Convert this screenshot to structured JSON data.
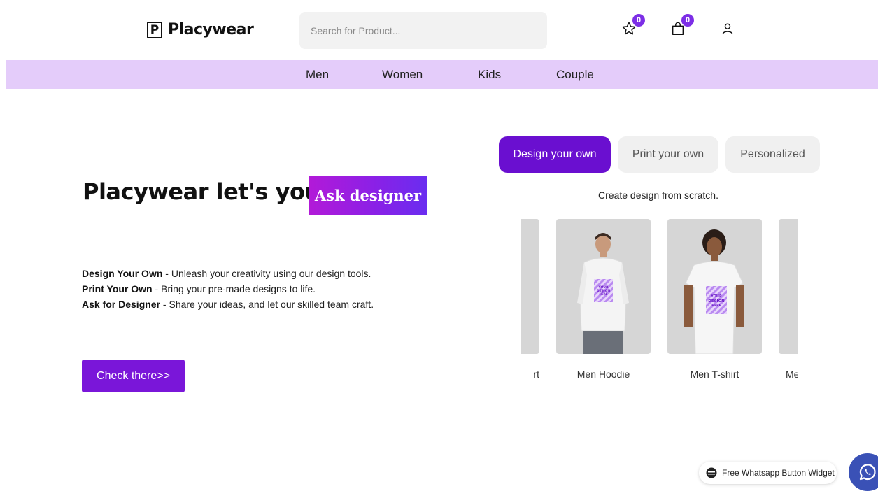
{
  "header": {
    "logo_mark": "P",
    "logo_text": "Placywear",
    "search_placeholder": "Search for Product...",
    "wishlist_count": "0",
    "cart_count": "0"
  },
  "nav": {
    "items": [
      "Men",
      "Women",
      "Kids",
      "Couple"
    ]
  },
  "hero": {
    "title": "Placywear let's you",
    "badge": "Ask designer",
    "lines": [
      {
        "bold": "Design Your Own",
        "text": " - Unleash your creativity using our design tools."
      },
      {
        "bold": "Print Your Own",
        "text": " - Bring your pre-made designs to life."
      },
      {
        "bold": "Ask for Designer",
        "text": " - Share your ideas, and let our skilled team craft."
      }
    ],
    "cta_label": "Check there>>"
  },
  "tabs": {
    "items": [
      "Design your own",
      "Print your own",
      "Personalized"
    ],
    "active_index": 0,
    "caption": "Create design from scratch."
  },
  "products": [
    {
      "label": "rt"
    },
    {
      "label": "Men Hoodie"
    },
    {
      "label": "Men T-shirt"
    },
    {
      "label": "Me"
    }
  ],
  "mockup_text": [
    "YOUR",
    "DESIGN",
    "HERE"
  ],
  "whatsapp": {
    "chip_label": "Free Whatsapp Button Widget"
  },
  "colors": {
    "accent": "#7a16d9",
    "nav_bg": "#e4ccfa",
    "badge": "#7c2ee6"
  }
}
